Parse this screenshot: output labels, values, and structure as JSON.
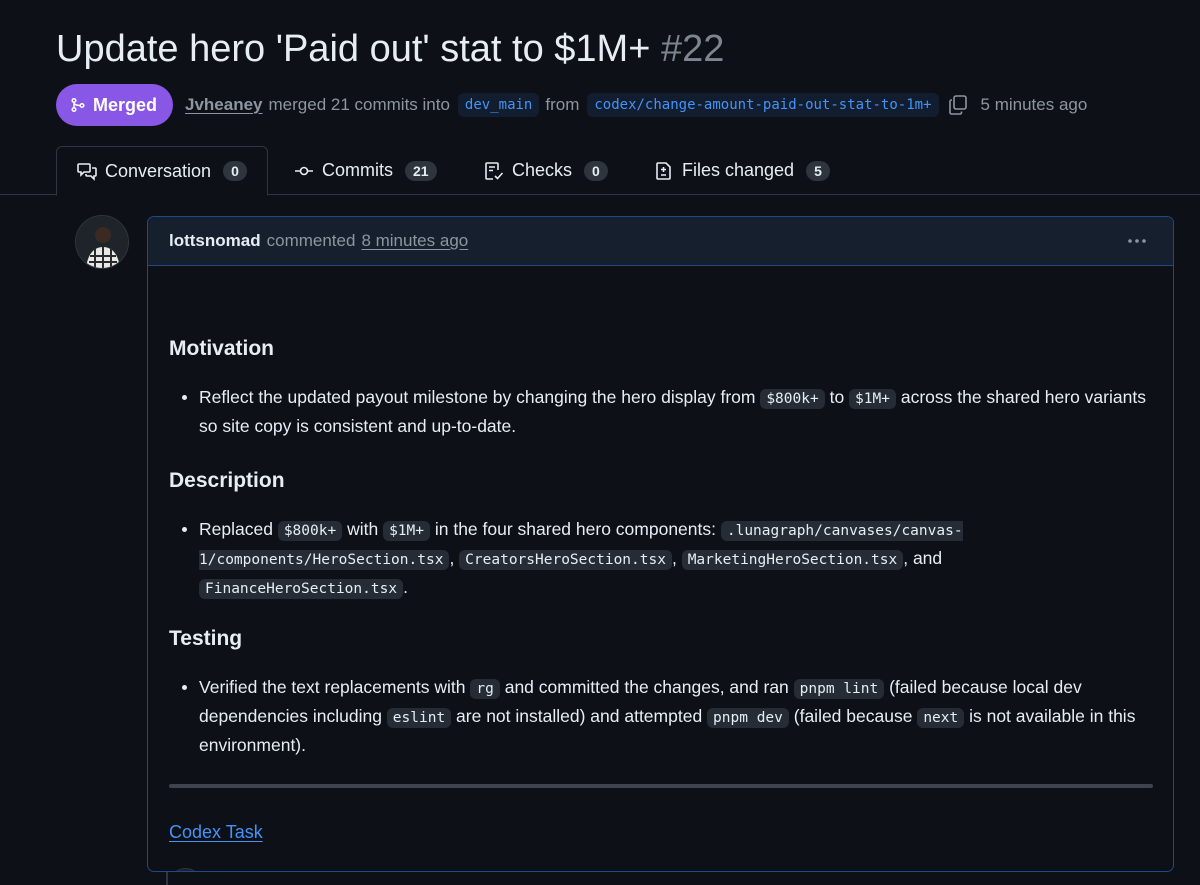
{
  "pr": {
    "title": "Update hero 'Paid out' stat to $1M+",
    "number": "#22",
    "status": "Merged",
    "author": "Jvheaney",
    "action": "merged 21 commits into",
    "base_branch": "dev_main",
    "from_word": "from",
    "head_branch": "codex/change-amount-paid-out-stat-to-1m+",
    "time": "5 minutes ago"
  },
  "tabs": [
    {
      "label": "Conversation",
      "count": "0",
      "icon": "comment-discussion-icon"
    },
    {
      "label": "Commits",
      "count": "21",
      "icon": "git-commit-icon"
    },
    {
      "label": "Checks",
      "count": "0",
      "icon": "checklist-icon"
    },
    {
      "label": "Files changed",
      "count": "5",
      "icon": "file-diff-icon"
    }
  ],
  "comment": {
    "user": "lottsnomad",
    "action": "commented",
    "time": "8 minutes ago",
    "sections": {
      "motivation": {
        "heading": "Motivation",
        "t1": "Reflect the updated payout milestone by changing the hero display from ",
        "c1": "$800k+",
        "t2": " to ",
        "c2": "$1M+",
        "t3": " across the shared hero variants so site copy is consistent and up-to-date."
      },
      "description": {
        "heading": "Description",
        "t1": "Replaced ",
        "c1": "$800k+",
        "t2": " with ",
        "c2": "$1M+",
        "t3": " in the four shared hero components: ",
        "c3": ".lunagraph/canvases/canvas-1/components/HeroSection.tsx",
        "t4": ", ",
        "c4": "CreatorsHeroSection.tsx",
        "t5": ", ",
        "c5": "MarketingHeroSection.tsx",
        "t6": ", and ",
        "c6": "FinanceHeroSection.tsx",
        "t7": "."
      },
      "testing": {
        "heading": "Testing",
        "t1": "Verified the text replacements with ",
        "c1": "rg",
        "t2": " and committed the changes, and ran ",
        "c2": "pnpm lint",
        "t3": " (failed because local dev dependencies including ",
        "c3": "eslint",
        "t4": " are not installed) and attempted ",
        "c4": "pnpm dev",
        "t5": " (failed because ",
        "c5": "next",
        "t6": " is not available in this environment)."
      }
    },
    "link": "Codex Task"
  },
  "colors": {
    "background": "#0d1117",
    "merged_badge": "#8957e5",
    "link": "#4493f8",
    "muted": "#8d96a0",
    "comment_border": "#1f4a82"
  },
  "icons": {
    "merge": "git-merge-icon",
    "copy": "copy-icon",
    "kebab": "kebab-horizontal-icon",
    "emoji": "smiley-icon"
  }
}
